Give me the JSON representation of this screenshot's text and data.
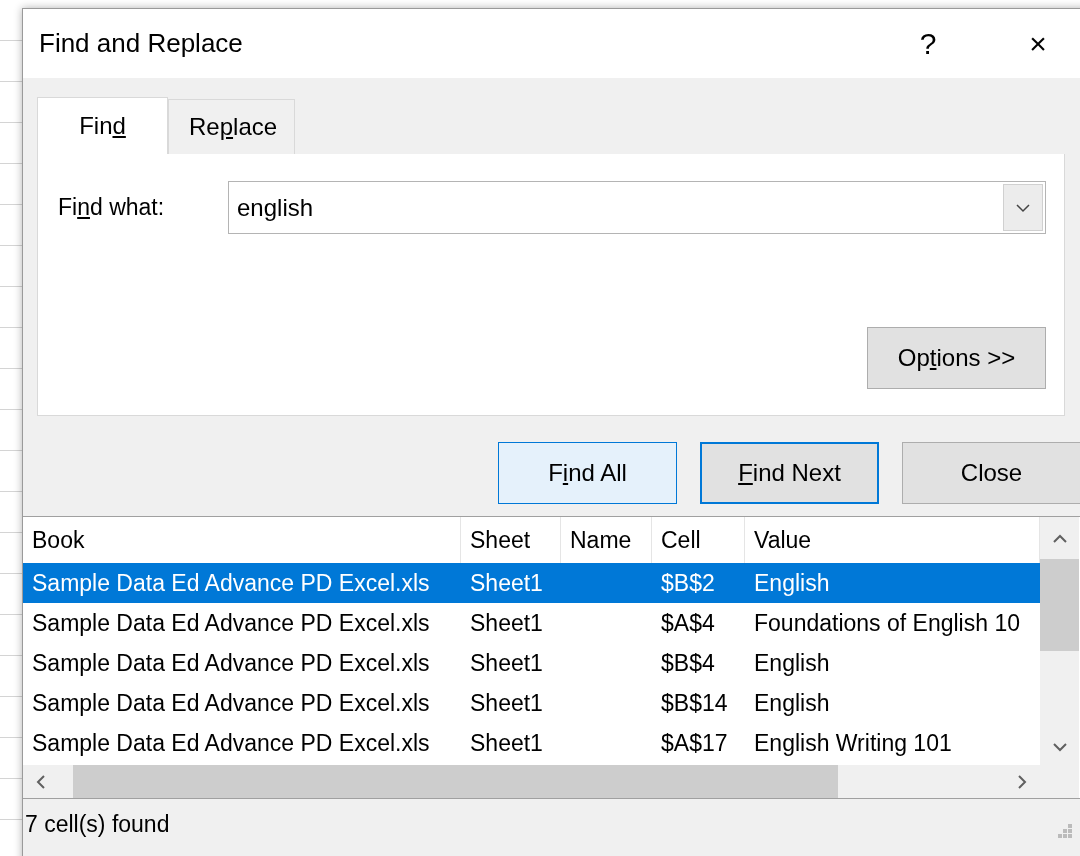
{
  "window": {
    "title": "Find and Replace",
    "help": "?",
    "close": "×"
  },
  "tabs": [
    {
      "label": {
        "pre": "Fin",
        "key": "d"
      },
      "selected": true
    },
    {
      "label": {
        "pre": "Re",
        "key": "p",
        "post": "lace"
      },
      "selected": false
    }
  ],
  "find_what": {
    "label": {
      "pre": "Fi",
      "key": "n",
      "post": "d what:"
    },
    "value": "english"
  },
  "options_button": {
    "pre": "Op",
    "key": "t",
    "post": "ions >>"
  },
  "buttons": [
    {
      "label": {
        "pre": "F",
        "key": "i",
        "post": "nd All"
      },
      "kind": "hover"
    },
    {
      "label": {
        "key": "F",
        "post": "ind Next"
      },
      "kind": "default"
    },
    {
      "label": {
        "pre": "Close"
      },
      "kind": "plain"
    }
  ],
  "results": {
    "columns": [
      "Book",
      "Sheet",
      "Name",
      "Cell",
      "Value"
    ],
    "rows": [
      {
        "cells": [
          "Sample Data Ed Advance PD Excel.xls",
          "Sheet1",
          "",
          "$B$2",
          "English"
        ],
        "selected": true
      },
      {
        "cells": [
          "Sample Data Ed Advance PD Excel.xls",
          "Sheet1",
          "",
          "$A$4",
          "Foundations of English 10"
        ],
        "selected": false
      },
      {
        "cells": [
          "Sample Data Ed Advance PD Excel.xls",
          "Sheet1",
          "",
          "$B$4",
          "English"
        ],
        "selected": false
      },
      {
        "cells": [
          "Sample Data Ed Advance PD Excel.xls",
          "Sheet1",
          "",
          "$B$14",
          "English"
        ],
        "selected": false
      },
      {
        "cells": [
          "Sample Data Ed Advance PD Excel.xls",
          "Sheet1",
          "",
          "$A$17",
          "English Writing 101"
        ],
        "selected": false
      }
    ]
  },
  "status_bar": "7 cell(s) found"
}
